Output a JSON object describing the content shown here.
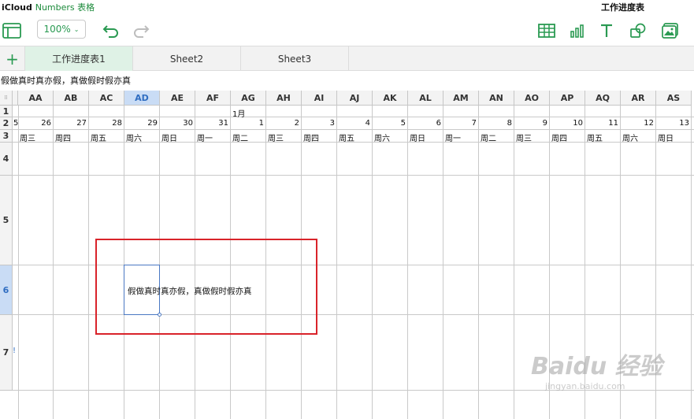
{
  "brand": {
    "icloud": "iCloud",
    "app": "Numbers 表格"
  },
  "document": {
    "title": "工作进度表"
  },
  "toolbar": {
    "zoom": "100%"
  },
  "tabs": [
    "工作进度表1",
    "Sheet2",
    "Sheet3"
  ],
  "formula_bar": {
    "value": "假做真时真亦假，真做假时假亦真"
  },
  "columns": [
    "AA",
    "AB",
    "AC",
    "AD",
    "AE",
    "AF",
    "AG",
    "AH",
    "AI",
    "AJ",
    "AK",
    "AL",
    "AM",
    "AN",
    "AO",
    "AP",
    "AQ",
    "AR",
    "AS"
  ],
  "selected_column": "AD",
  "rows": [
    "1",
    "2",
    "3",
    "4",
    "5",
    "6",
    "7"
  ],
  "selected_row": "6",
  "row1": {
    "month_label": "1月"
  },
  "row2": {
    "leading": "5",
    "days": [
      "26",
      "27",
      "28",
      "29",
      "30",
      "31",
      "1",
      "2",
      "3",
      "4",
      "5",
      "6",
      "7",
      "8",
      "9",
      "10",
      "11",
      "12",
      "13"
    ]
  },
  "row3": {
    "weekdays": [
      "周三",
      "周四",
      "周五",
      "周六",
      "周日",
      "周一",
      "周二",
      "周三",
      "周四",
      "周五",
      "周六",
      "周日",
      "周一",
      "周二",
      "周三",
      "周四",
      "周五",
      "周六",
      "周日"
    ]
  },
  "cell_ad6": {
    "text": "假做真时真亦假，真做假时假亦真"
  },
  "row7": {
    "marker": "!"
  },
  "watermark": {
    "main": "Baidu 经验",
    "sub": "jingyan.baidu.com"
  },
  "colors": {
    "accent": "#2a9a52",
    "selection": "#4a78c2",
    "highlight_box": "#d9232a"
  }
}
